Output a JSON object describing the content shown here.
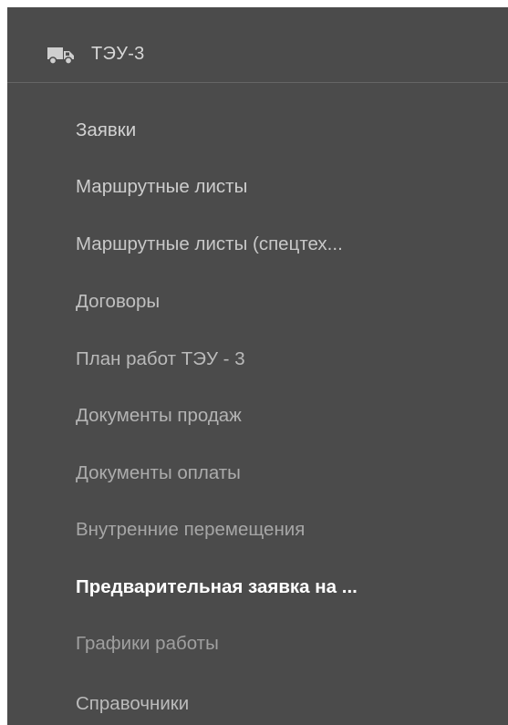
{
  "header": {
    "icon": "truck-icon",
    "title": "ТЭУ-3"
  },
  "menu": {
    "items": [
      {
        "label": "Заявки",
        "color": "#d2d2d2"
      },
      {
        "label": "Маршрутные листы",
        "color": "#cdcdcd"
      },
      {
        "label": "Маршрутные листы (спецтех...",
        "color": "#c8c8c8"
      },
      {
        "label": "Договоры",
        "color": "#c0c0c0"
      },
      {
        "label": "План работ ТЭУ - 3",
        "color": "#bababa"
      },
      {
        "label": "Документы продаж",
        "color": "#b3b3b3"
      },
      {
        "label": "Документы оплаты",
        "color": "#acacac"
      },
      {
        "label": "Внутренние перемещения",
        "color": "#a6a6a6"
      },
      {
        "label": "Предварительная заявка на ...",
        "color": "#ffffff",
        "active": true
      },
      {
        "label": "Графики работы",
        "color": "#a0a0a0"
      },
      {
        "label": "Справочники",
        "color": "#bbbbbb"
      }
    ]
  }
}
